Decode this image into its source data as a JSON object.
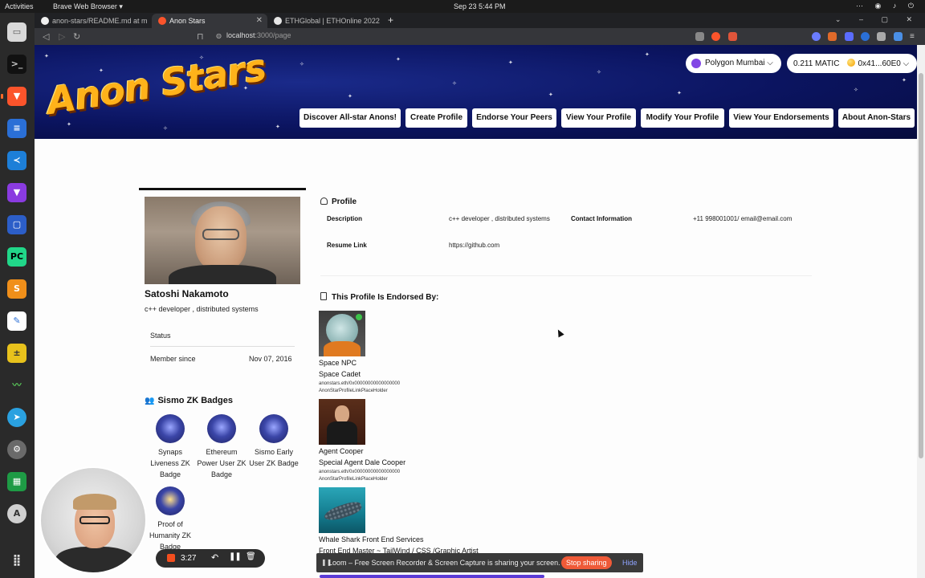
{
  "system": {
    "activities": "Activities",
    "app_name": "Brave Web Browser ▾",
    "clock": "Sep 23  5:44 PM"
  },
  "browser": {
    "tabs": [
      {
        "label": "anon-stars/README.md at m",
        "color": "#f0f0f0"
      },
      {
        "label": "Anon Stars",
        "color": "#fb542b"
      },
      {
        "label": "ETHGlobal | ETHOnline 2022",
        "color": "#e6e6e6"
      }
    ],
    "new_tab": "+",
    "url_host": "localhost",
    "url_path": ":3000/page"
  },
  "site": {
    "logo_text": "Anon Stars",
    "network": "Polygon Mumbai ⌵",
    "wallet_balance": "0.211 MATIC",
    "wallet_address": "0x41...60E0 ⌵",
    "nav": [
      "Discover All-star Anons!",
      "Create Profile",
      "Endorse Your Peers",
      "View Your Profile",
      "Modify Your Profile",
      "View Your Endorsements",
      "About Anon-Stars"
    ]
  },
  "profile": {
    "name": "Satoshi Nakamoto",
    "short_desc": "c++ developer , distributed systems",
    "status_label": "Status",
    "member_label": "Member since",
    "member_value": "Nov 07, 2016",
    "section_title": "Profile",
    "description_label": "Description",
    "description_value": "c++ developer , distributed systems",
    "contact_label": "Contact Information",
    "contact_value": "+11 998001001/ email@email.com",
    "resume_label": "Resume Link",
    "resume_value": "https://github.com"
  },
  "badges": {
    "title": "Sismo ZK Badges",
    "items": [
      {
        "label": "Synaps Liveness ZK Badge"
      },
      {
        "label": "Ethereum Power User ZK Badge"
      },
      {
        "label": "Sismo Early User ZK Badge"
      },
      {
        "label": "Proof of Humanity ZK Badge"
      }
    ]
  },
  "endorsements": {
    "title": "This Profile Is Endorsed By:",
    "items": [
      {
        "name": "Space NPC",
        "title": "Space Cadet",
        "link1": "anonstars.eth/0x00000000000000000",
        "link2": "AnonStarProfileLinkPlaceHolder"
      },
      {
        "name": "Agent Cooper",
        "title": "Special Agent Dale Cooper",
        "link1": "anonstars.eth/0x00000000000000000",
        "link2": "AnonStarProfileLinkPlaceHolder"
      },
      {
        "name": "Whale Shark Front End Services",
        "title": "Front End Master ~ TailWind / CSS /Graphic Artist"
      }
    ]
  },
  "loom": {
    "timer": "3:27",
    "share_message": "Loom – Free Screen Recorder & Screen Capture is sharing your screen.",
    "stop_label": "Stop sharing",
    "hide_label": "Hide"
  },
  "colors": {
    "hero_bg": "#0b1460",
    "logo": "#ffb21a",
    "polygon": "#8247e5",
    "loom_stop": "#ef5a38"
  }
}
